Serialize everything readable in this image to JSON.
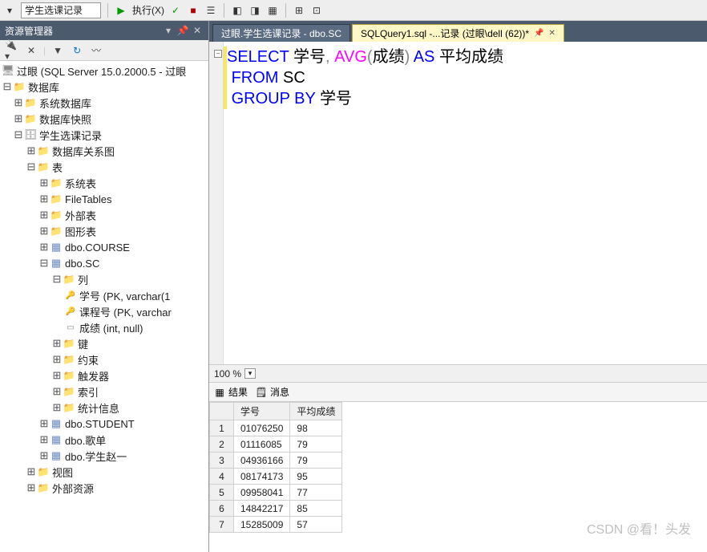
{
  "toolbar": {
    "combo_value": "学生选课记录",
    "exec": "执行(X)"
  },
  "explorer": {
    "title": "资源管理器",
    "server": "过眼 (SQL Server 15.0.2000.5 - 过眼",
    "nodes": {
      "db": "数据库",
      "sysdb": "系统数据库",
      "snap": "数据库快照",
      "studentdb": "学生选课记录",
      "diagram": "数据库关系图",
      "tables": "表",
      "systables": "系统表",
      "filetables": "FileTables",
      "external": "外部表",
      "graph": "图形表",
      "course": "dbo.COURSE",
      "sc": "dbo.SC",
      "cols": "列",
      "col1": "学号 (PK, varchar(1",
      "col2": "课程号 (PK, varchar",
      "col3": "成绩 (int, null)",
      "keys": "键",
      "constraints": "约束",
      "triggers": "触发器",
      "indexes": "索引",
      "stats": "统计信息",
      "student": "dbo.STUDENT",
      "playlist": "dbo.歌单",
      "zhao": "dbo.学生赵一",
      "views": "视图",
      "extres": "外部资源"
    }
  },
  "tabs": {
    "t1": "过眼.学生选课记录 - dbo.SC",
    "t2": "SQLQuery1.sql -...记录 (过眼\\dell (62))*"
  },
  "code": {
    "select": "SELECT",
    "col1": "学号",
    "avg": "AVG",
    "lp": "(",
    "argc": "成绩",
    "rp": ")",
    "as": "AS",
    "alias": "平均成绩",
    "from": "FROM",
    "tbl": "SC",
    "groupby": "GROUP BY",
    "gcol": "学号",
    "comma": ", "
  },
  "zoom": {
    "value": "100 %"
  },
  "results": {
    "tab1": "结果",
    "tab2": "消息"
  },
  "grid": {
    "headers": [
      "学号",
      "平均成绩"
    ],
    "rows": [
      [
        "01076250",
        "98"
      ],
      [
        "01116085",
        "79"
      ],
      [
        "04936166",
        "79"
      ],
      [
        "08174173",
        "95"
      ],
      [
        "09958041",
        "77"
      ],
      [
        "14842217",
        "85"
      ],
      [
        "15285009",
        "57"
      ]
    ]
  },
  "watermark": "CSDN @看！头发"
}
